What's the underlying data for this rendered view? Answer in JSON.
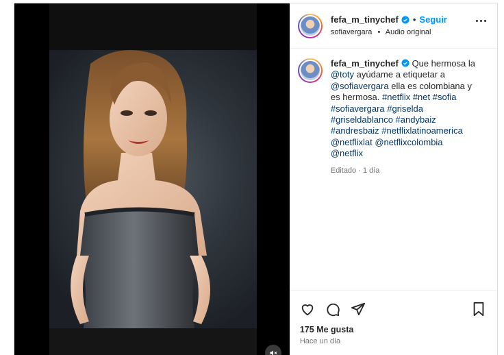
{
  "post": {
    "author": "fefa_m_tinychef",
    "follow_label": "Seguir",
    "separator": "•",
    "audio_user": "sofiavergara",
    "audio_label": "Audio original",
    "caption_intro": " Que hermosa la ",
    "mention_toty": "@toty",
    "caption_mid1": " ayúdame a etiquetar a ",
    "mention_sofia": "@sofiavergara",
    "caption_mid2": " ella es colombiana y es hermosa. ",
    "hashtags_line1": "#netflix #net #sofia #sofiavergara #griselda #griseldablanco #andybaiz #andresbaiz #netflixlatinoamerica",
    "mentions_tail": "@netflixlat @netflixcolombia @netflix",
    "edited": "Editado · 1 día",
    "likes": "175 Me gusta",
    "time_ago": "Hace un día"
  },
  "icons": {
    "verified": "verified-badge-icon",
    "more": "more-options-icon",
    "like": "heart-icon",
    "comment": "comment-icon",
    "share": "send-icon",
    "save": "bookmark-icon",
    "mute": "muted-speaker-icon"
  },
  "colors": {
    "link": "#00376b",
    "follow": "#0095f6",
    "verified": "#0095f6",
    "muted_text": "#737373"
  }
}
